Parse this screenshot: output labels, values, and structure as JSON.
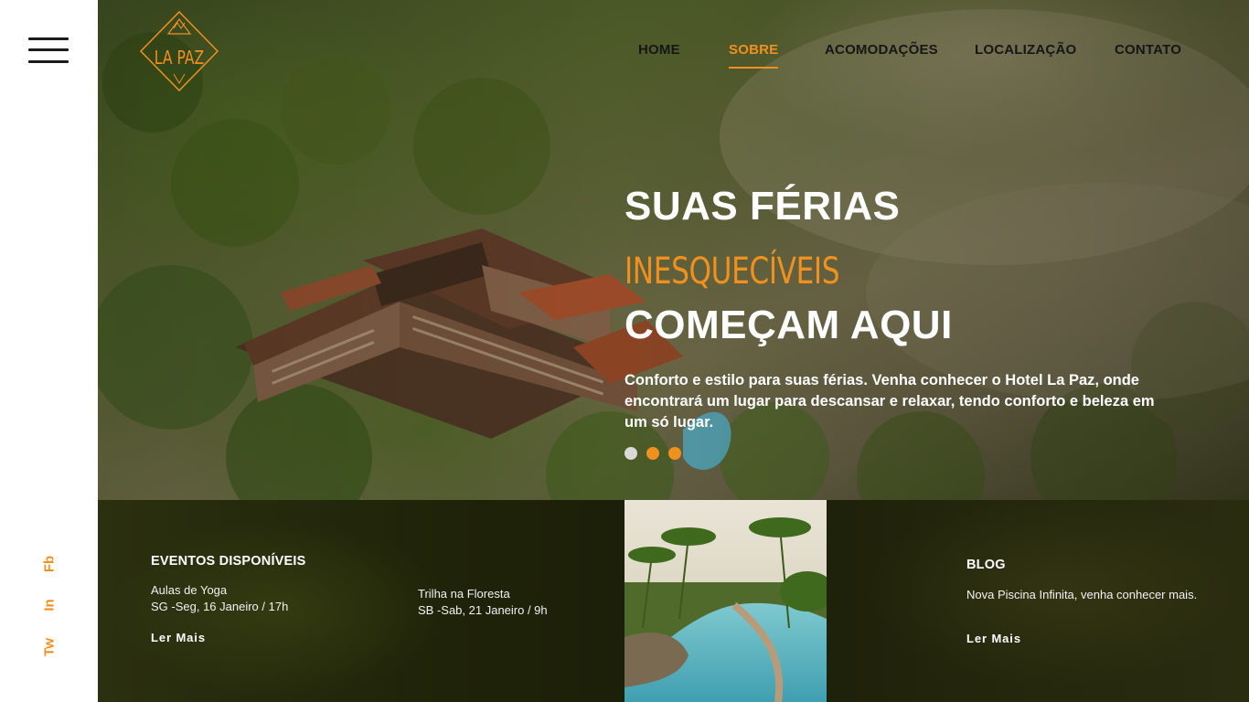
{
  "brand": {
    "logo_text": "LA PAZ",
    "accent_color": "#f0901e"
  },
  "sidebar": {
    "menu_icon": "hamburger-menu-icon",
    "social": [
      {
        "label": "Fb",
        "name": "facebook"
      },
      {
        "label": "In",
        "name": "linkedin"
      },
      {
        "label": "Tw",
        "name": "twitter"
      }
    ]
  },
  "nav": {
    "items": [
      {
        "label": "HOME",
        "active": false
      },
      {
        "label": "SOBRE",
        "active": true
      },
      {
        "label": "ACOMODAÇÕES",
        "active": false
      },
      {
        "label": "LOCALIZAÇÃO",
        "active": false
      },
      {
        "label": "CONTATO",
        "active": false
      }
    ]
  },
  "hero": {
    "line1": "SUAS FÉRIAS",
    "line2": "INESQUECÍVEIS",
    "line3": "COMEÇAM AQUI",
    "description": "Conforto e estilo para suas férias. Venha conhecer o Hotel La Paz, onde encontrará um lugar para descansar e relaxar, tendo conforto e beleza em um só lugar.",
    "slides": [
      {
        "color": "#d9d9d9"
      },
      {
        "color": "#f0901e"
      },
      {
        "color": "#f0901e"
      }
    ]
  },
  "events": {
    "title": "EVENTOS DISPONÍVEIS",
    "items": [
      {
        "name": "Aulas de Yoga",
        "when": "SG -Seg, 16 Janeiro / 17h"
      },
      {
        "name": "Trilha na Floresta",
        "when": "SB -Sab, 21 Janeiro / 9h"
      }
    ],
    "link": "Ler Mais"
  },
  "blog": {
    "title": "BLOG",
    "text": "Nova Piscina Infinita, venha conhecer mais.",
    "link": "Ler Mais"
  }
}
